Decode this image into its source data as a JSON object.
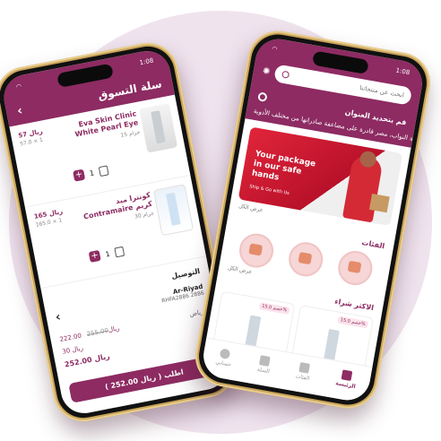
{
  "colors": {
    "brand": "#8d2b62",
    "background_circle": "#efe3ee"
  },
  "left_phone": {
    "status_time": "1:08",
    "header_title": "سلة التسوق",
    "items": [
      {
        "name": "Eva Skin Clinic White Pearl Eye",
        "price": "57 ريال",
        "sub": "57.0 × 1",
        "weight": "15 جرام",
        "qty": "1"
      },
      {
        "name": "كونترا ميد Contramaire كريم",
        "price": "165 ريال",
        "sub": "165.0 × 1",
        "weight": "30 جرام",
        "qty": "1"
      }
    ],
    "delivery_title": "التوصيل",
    "address_name": "Ar-Riyad",
    "address_code": "RHFA2886 2886",
    "sub_total": "222.00 ريال",
    "sub_total_old": "255.00",
    "region_label": "الرياض",
    "shipping": "30 ريال",
    "total": "252.00 ريال",
    "order_button": "( 252.00 ريال ) اطلب"
  },
  "right_phone": {
    "status_time": "1:08",
    "search_placeholder": "ابحث عن منتجاتنا",
    "location_title": "قم بتحديد العنوان",
    "marquee": "صحة النواب، مصر قادرة على مضاعفة صادراتها من مختلف الأدوية",
    "banner_text": "Your package in our safe hands",
    "banner_sub": "Ship & Go with Us",
    "view_all_1": "عرض الكل",
    "categories_title": "الفئات",
    "view_all_2": "عرض الكل",
    "best_sellers_title": "الاكثر شراء",
    "discount_1": "خصم 15.0%",
    "discount_2": "خصم 15.0%",
    "tabs": [
      {
        "label": "الرئيسة",
        "icon": "home-icon",
        "active": true
      },
      {
        "label": "الفئات",
        "icon": "grid-icon",
        "active": false
      },
      {
        "label": "السلة",
        "icon": "cart-icon",
        "active": false
      },
      {
        "label": "حسابي",
        "icon": "person-icon",
        "active": false
      }
    ]
  }
}
